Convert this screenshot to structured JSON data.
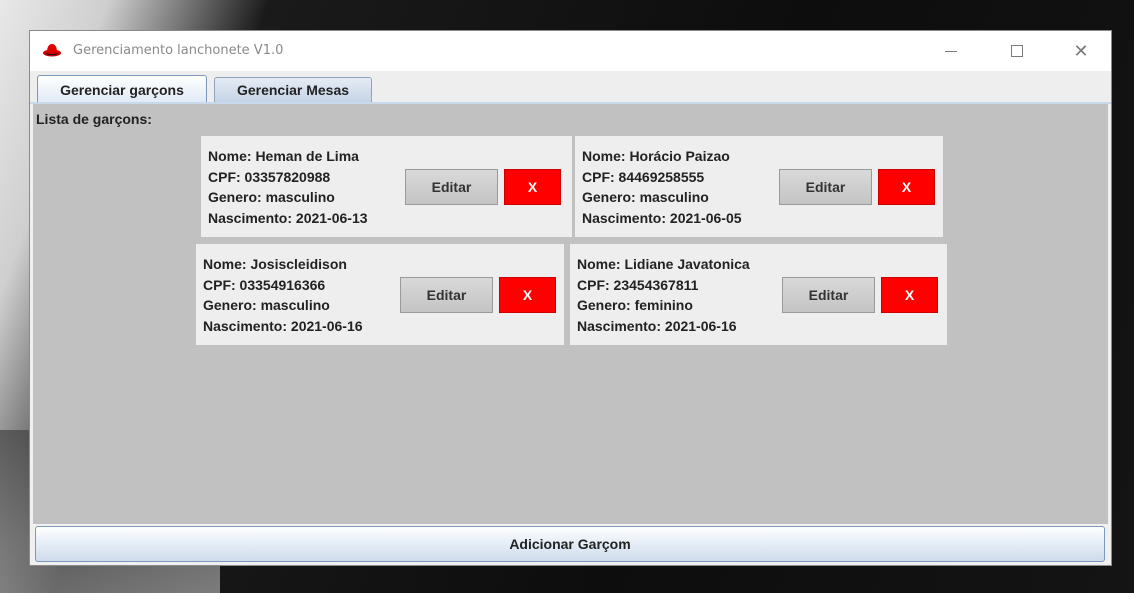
{
  "window": {
    "title": "Gerenciamento lanchonete V1.0",
    "controls": {
      "minimize_icon": "minimize-icon",
      "maximize_icon": "maximize-icon",
      "close_icon": "close-icon",
      "close_glyph": "✕"
    }
  },
  "tabs": [
    {
      "label": "Gerenciar garçons",
      "selected": true
    },
    {
      "label": "Gerenciar Mesas",
      "selected": false
    }
  ],
  "list": {
    "heading": "Lista de garçons:",
    "waiters": [
      {
        "nome": "Nome: Heman de Lima",
        "cpf": "CPF: 03357820988",
        "genero": "Genero: masculino",
        "nascimento": "Nascimento: 2021-06-13",
        "edit_label": "Editar",
        "delete_label": "X"
      },
      {
        "nome": "Nome: Horácio Paizao",
        "cpf": "CPF: 84469258555",
        "genero": "Genero: masculino",
        "nascimento": "Nascimento: 2021-06-05",
        "edit_label": "Editar",
        "delete_label": "X"
      },
      {
        "nome": "Nome: Josiscleidison",
        "cpf": "CPF: 03354916366",
        "genero": "Genero: masculino",
        "nascimento": "Nascimento: 2021-06-16",
        "edit_label": "Editar",
        "delete_label": "X"
      },
      {
        "nome": "Nome: Lidiane Javatonica",
        "cpf": "CPF: 23454367811",
        "genero": "Genero: feminino",
        "nascimento": "Nascimento: 2021-06-16",
        "edit_label": "Editar",
        "delete_label": "X"
      }
    ]
  },
  "footer": {
    "add_label": "Adicionar Garçom"
  },
  "colors": {
    "delete_button": "#ff0000",
    "content_background": "#c1c1c1",
    "card_background": "#eeeeee",
    "app_icon": "#d40000"
  }
}
